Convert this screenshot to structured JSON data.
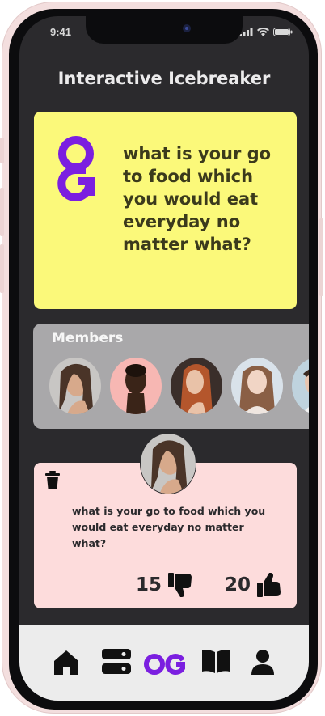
{
  "status_bar": {
    "time": "9:41"
  },
  "app": {
    "title": "Interactive Icebreaker"
  },
  "question_card": {
    "logo_text": "OG",
    "question": "what is your go to food which you would eat everyday no matter what?"
  },
  "members": {
    "label": "Members",
    "avatars": [
      {
        "name": "member-1"
      },
      {
        "name": "member-2"
      },
      {
        "name": "member-3"
      },
      {
        "name": "member-4"
      },
      {
        "name": "member-5"
      }
    ]
  },
  "post": {
    "text": "what is your go to food which you would eat everyday no matter what?",
    "dislikes": "15",
    "likes": "20"
  },
  "tabs": [
    {
      "icon": "home-icon"
    },
    {
      "icon": "list-icon"
    },
    {
      "icon": "og-logo-icon"
    },
    {
      "icon": "book-icon"
    },
    {
      "icon": "profile-icon"
    }
  ],
  "colors": {
    "accent": "#7b1fe0",
    "card_yellow": "#fbf97a",
    "card_pink": "#fddcdc",
    "background": "#2b2a2d"
  }
}
